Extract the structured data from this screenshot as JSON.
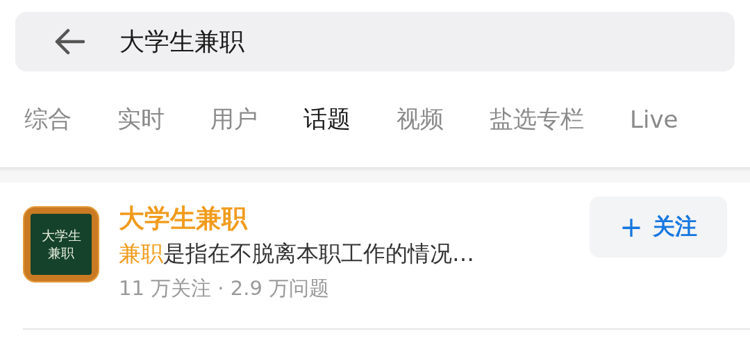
{
  "search": {
    "value": "大学生兼职"
  },
  "tabs": [
    {
      "label": "综合",
      "selected": false
    },
    {
      "label": "实时",
      "selected": false
    },
    {
      "label": "用户",
      "selected": false
    },
    {
      "label": "话题",
      "selected": true
    },
    {
      "label": "视频",
      "selected": false
    },
    {
      "label": "盐选专栏",
      "selected": false
    },
    {
      "label": "Live",
      "selected": false
    }
  ],
  "topic": {
    "board_lines": [
      "大学生",
      "兼职"
    ],
    "title": "大学生兼职",
    "description_highlight": "兼职",
    "description_rest": "是指在不脱离本职工作的情况…",
    "meta": "11 万关注 · 2.9 万问题",
    "follow_button": {
      "icon": "+",
      "label": "关注"
    }
  }
}
